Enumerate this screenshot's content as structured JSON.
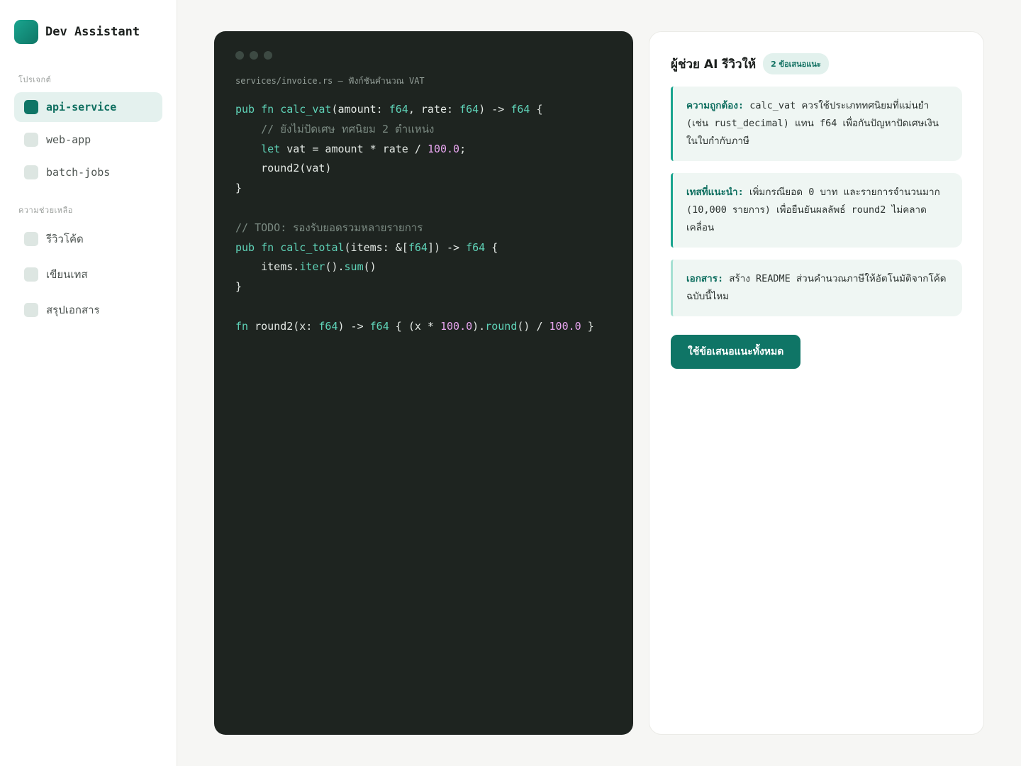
{
  "app": {
    "name": "Dev Assistant"
  },
  "sidebar": {
    "projects_label": "โปรเจกต์",
    "projects": [
      {
        "label": "api-service",
        "active": true
      },
      {
        "label": "web-app",
        "active": false
      },
      {
        "label": "batch-jobs",
        "active": false
      }
    ],
    "help_label": "ความช่วยเหลือ",
    "help_items": [
      {
        "label": "รีวิวโค้ด"
      },
      {
        "label": "เขียนเทส"
      },
      {
        "label": "สรุปเอกสาร"
      }
    ]
  },
  "editor": {
    "file_path": "services/invoice.rs — ฟังก์ชันคำนวณ VAT",
    "lines": [
      "pub fn calc_vat(amount: f64, rate: f64) -> f64 {",
      "    // ยังไม่ปัดเศษ ทศนิยม 2 ตำแหน่ง",
      "    let vat = amount * rate / 100.0;",
      "    round2(vat)",
      "}",
      "",
      "// TODO: รองรับยอดรวมหลายรายการ",
      "pub fn calc_total(items: &[f64]) -> f64 {",
      "    items.iter().sum()",
      "}",
      "",
      "fn round2(x: f64) -> f64 { (x * 100.0).round() / 100.0 }"
    ]
  },
  "review": {
    "title": "ผู้ช่วย AI รีวิวให้",
    "badge": "2 ข้อเสนอแนะ",
    "cards": [
      {
        "title": "ความถูกต้อง:",
        "text": "calc_vat ควรใช้ประเภททศนิยมที่แม่นยำ (เช่น rust_decimal) แทน f64 เพื่อกันปัญหาปัดเศษเงินในใบกำกับภาษี"
      },
      {
        "title": "เทสที่แนะนำ:",
        "text": "เพิ่มกรณียอด 0 บาท และรายการจำนวนมาก (10,000 รายการ) เพื่อยืนยันผลลัพธ์ round2 ไม่คลาดเคลื่อน"
      },
      {
        "title": "เอกสาร:",
        "text": "สร้าง README ส่วนคำนวณภาษีให้อัตโนมัติจากโค้ดฉบับนี้ไหม"
      }
    ],
    "apply_button": "ใช้ข้อเสนอแนะทั้งหมด"
  },
  "colors": {
    "accent": "#0f7566",
    "accent_light": "#1aa58f",
    "code_bg": "#1e2420",
    "page_bg": "#f6f6f4"
  }
}
